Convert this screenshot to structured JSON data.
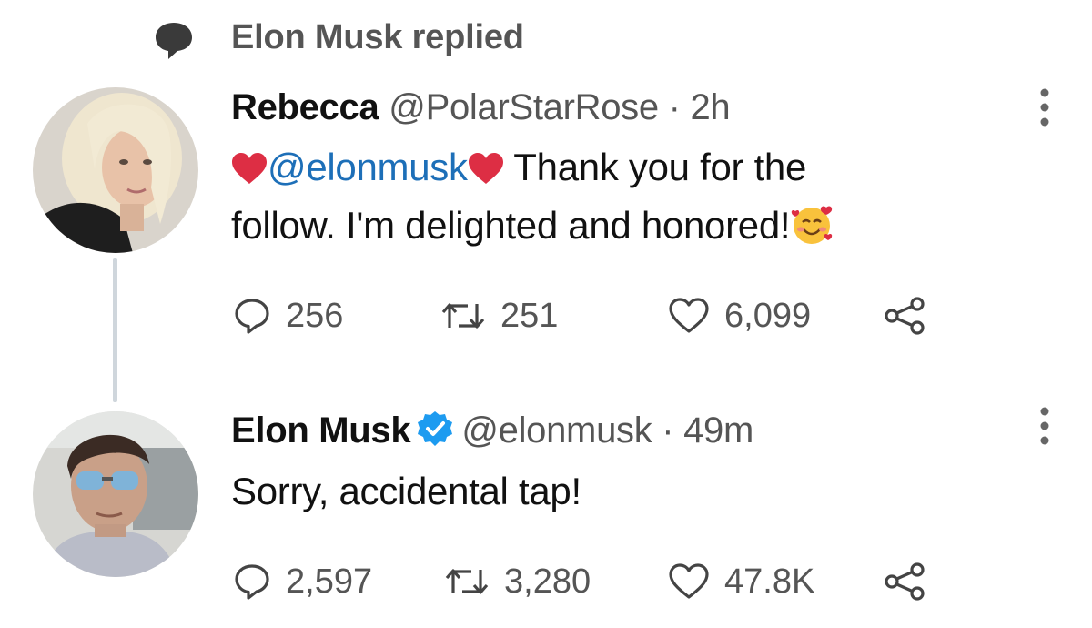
{
  "context": {
    "text": "Elon Musk replied",
    "icon": "speech-bubble-icon"
  },
  "tweets": [
    {
      "author": "Rebecca",
      "handle_time": "@PolarStarRose · 2h",
      "verified": false,
      "body": {
        "mention": "@elonmusk",
        "line1_rest": " Thank you for the",
        "line2": "follow.  I'm delighted and honored!"
      },
      "stats": {
        "replies": "256",
        "retweets": "251",
        "likes": "6,099"
      }
    },
    {
      "author": "Elon Musk",
      "handle_time": "@elonmusk · 49m",
      "verified": true,
      "body": {
        "text": "Sorry, accidental tap!"
      },
      "stats": {
        "replies": "2,597",
        "retweets": "3,280",
        "likes": "47.8K"
      }
    }
  ],
  "colors": {
    "mention": "#1d6fb8",
    "verified": "#1d9bf0",
    "heart_emoji": "#dd2e44",
    "muted": "#555555"
  }
}
